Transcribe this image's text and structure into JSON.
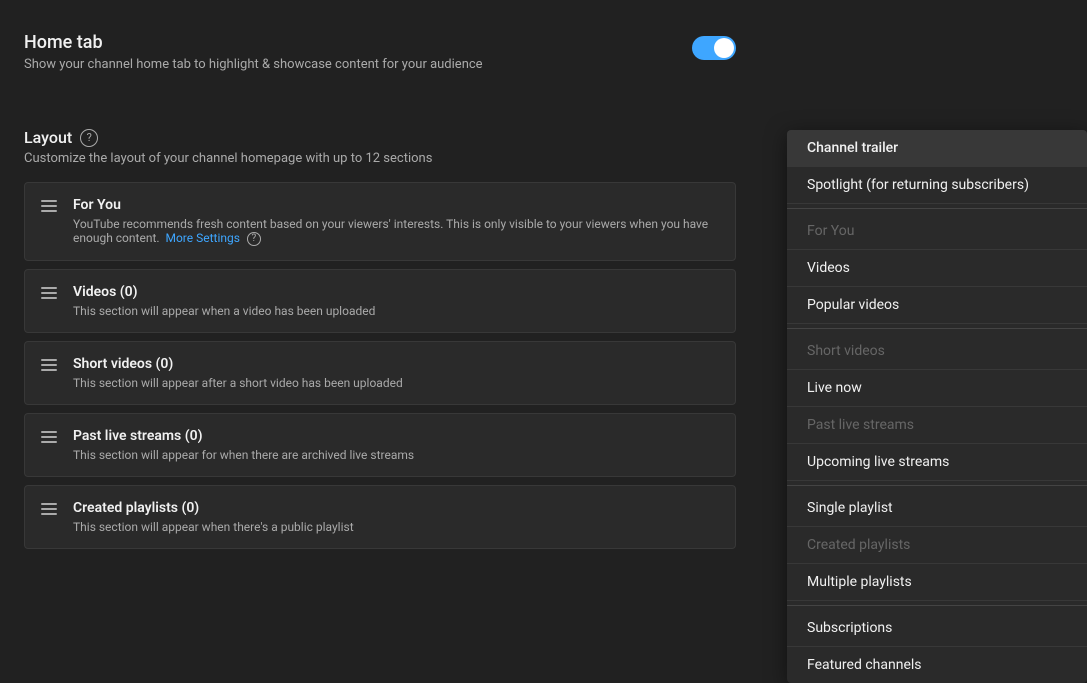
{
  "page": {
    "home_tab": {
      "title": "Home tab",
      "description": "Show your channel home tab to highlight & showcase content for your audience",
      "toggle_on": true
    },
    "layout": {
      "title": "Layout",
      "description": "Customize the layout of your channel homepage with up to 12 sections",
      "help_icon": "?"
    },
    "sections": [
      {
        "id": "for-you",
        "title": "For You",
        "description": "YouTube recommends fresh content based on your viewers' interests. This is only visible to your viewers when you have enough content.",
        "has_more_settings": true,
        "more_settings_label": "More Settings",
        "has_help": true
      },
      {
        "id": "videos",
        "title": "Videos (0)",
        "description": "This section will appear when a video has been uploaded",
        "has_more_settings": false
      },
      {
        "id": "short-videos",
        "title": "Short videos (0)",
        "description": "This section will appear after a short video has been uploaded",
        "has_more_settings": false
      },
      {
        "id": "past-live-streams",
        "title": "Past live streams (0)",
        "description": "This section will appear for when there are archived live streams",
        "has_more_settings": false
      },
      {
        "id": "created-playlists",
        "title": "Created playlists (0)",
        "description": "This section will appear when there's a public playlist",
        "has_more_settings": false
      }
    ],
    "dropdown": {
      "items": [
        {
          "label": "Channel trailer",
          "state": "active"
        },
        {
          "label": "Spotlight (for returning subscribers)",
          "state": "enabled"
        },
        {
          "label": "divider"
        },
        {
          "label": "For You",
          "state": "disabled"
        },
        {
          "label": "Videos",
          "state": "enabled"
        },
        {
          "label": "Popular videos",
          "state": "enabled"
        },
        {
          "label": "divider"
        },
        {
          "label": "Short videos",
          "state": "disabled"
        },
        {
          "label": "Live now",
          "state": "enabled"
        },
        {
          "label": "Past live streams",
          "state": "disabled"
        },
        {
          "label": "Upcoming live streams",
          "state": "enabled"
        },
        {
          "label": "divider"
        },
        {
          "label": "Single playlist",
          "state": "enabled"
        },
        {
          "label": "Created playlists",
          "state": "disabled"
        },
        {
          "label": "Multiple playlists",
          "state": "enabled"
        },
        {
          "label": "divider"
        },
        {
          "label": "Subscriptions",
          "state": "enabled"
        },
        {
          "label": "Featured channels",
          "state": "enabled"
        }
      ]
    }
  }
}
